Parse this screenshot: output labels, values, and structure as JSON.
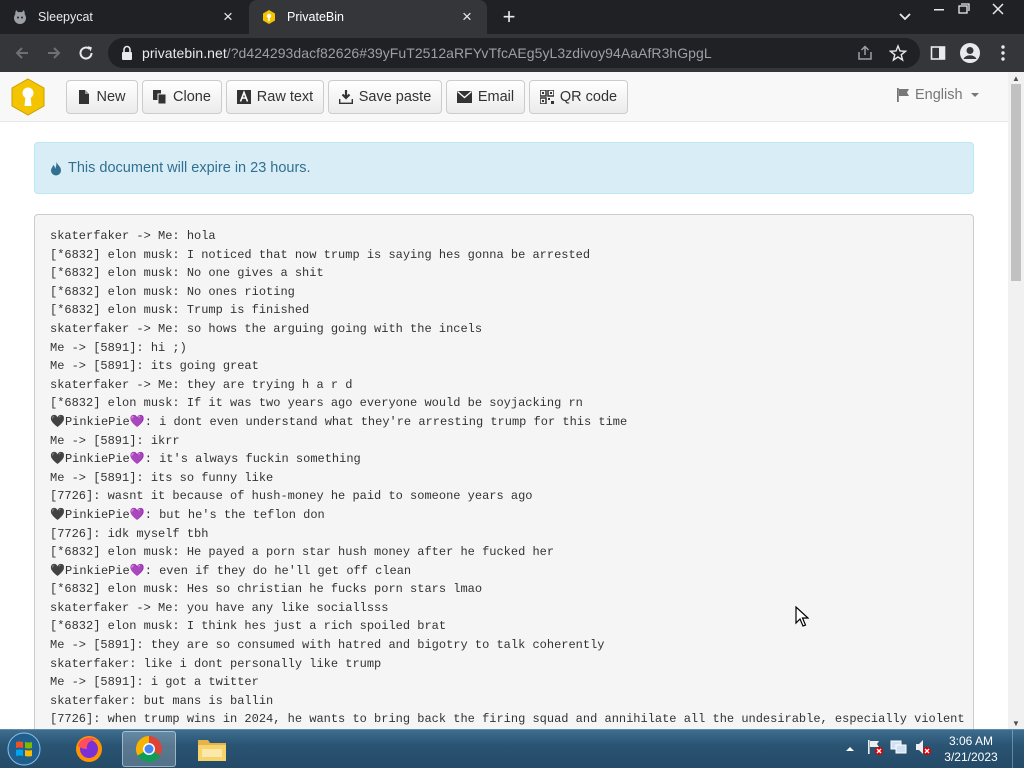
{
  "browser": {
    "tabs": [
      {
        "title": "Sleepycat",
        "active": false,
        "icon": "sleepycat-favicon"
      },
      {
        "title": "PrivateBin",
        "active": true,
        "icon": "privatebin-favicon"
      }
    ],
    "url_host": "privatebin.net",
    "url_rest": "/?d424293dacf82626#39yFuT2512aRFYvTfcAEg5yL3zdivoy94AaAfR3hGpgL"
  },
  "privatebin": {
    "buttons": {
      "new": "New",
      "clone": "Clone",
      "raw": "Raw text",
      "save": "Save paste",
      "email": "Email",
      "qr": "QR code"
    },
    "language": "English",
    "expiry_notice": "This document will expire in 23 hours.",
    "paste_lines": [
      "skaterfaker -> Me: hola",
      "[*6832] elon musk: I noticed that now trump is saying hes gonna be arrested",
      "[*6832] elon musk: No one gives a shit",
      "[*6832] elon musk: No ones rioting",
      "[*6832] elon musk: Trump is finished",
      "skaterfaker -> Me: so hows the arguing going with the incels",
      "Me -> [5891]: hi ;)",
      "Me -> [5891]: its going great",
      "skaterfaker -> Me: they are trying h a r d",
      "[*6832] elon musk: If it was two years ago everyone would be soyjacking rn",
      "🖤PinkiePie💜: i dont even understand what they're arresting trump for this time",
      "Me -> [5891]: ikrr",
      "🖤PinkiePie💜: it's always fuckin something",
      "Me -> [5891]: its so funny like",
      "[7726]: wasnt it because of hush-money he paid to someone years ago",
      "🖤PinkiePie💜: but he's the teflon don",
      "[7726]: idk myself tbh",
      "[*6832] elon musk: He payed a porn star hush money after he fucked her",
      "🖤PinkiePie💜: even if they do he'll get off clean",
      "[*6832] elon musk: Hes so christian he fucks porn stars lmao",
      "skaterfaker -> Me: you have any like sociallsss",
      "[*6832] elon musk: I think hes just a rich spoiled brat",
      "Me -> [5891]: they are so consumed with hatred and bigotry to talk coherently",
      "skaterfaker: like i dont personally like trump",
      "Me -> [5891]: i got a twitter",
      "skaterfaker: but mans is ballin",
      "[7726]: when trump wins in 2024, he wants to bring back the firing squad and annihilate all the undesirable, especially violent"
    ]
  },
  "taskbar": {
    "time": "3:06 AM",
    "date": "3/21/2023",
    "apps": [
      "firefox-icon",
      "chrome-icon",
      "file-explorer-icon"
    ]
  }
}
